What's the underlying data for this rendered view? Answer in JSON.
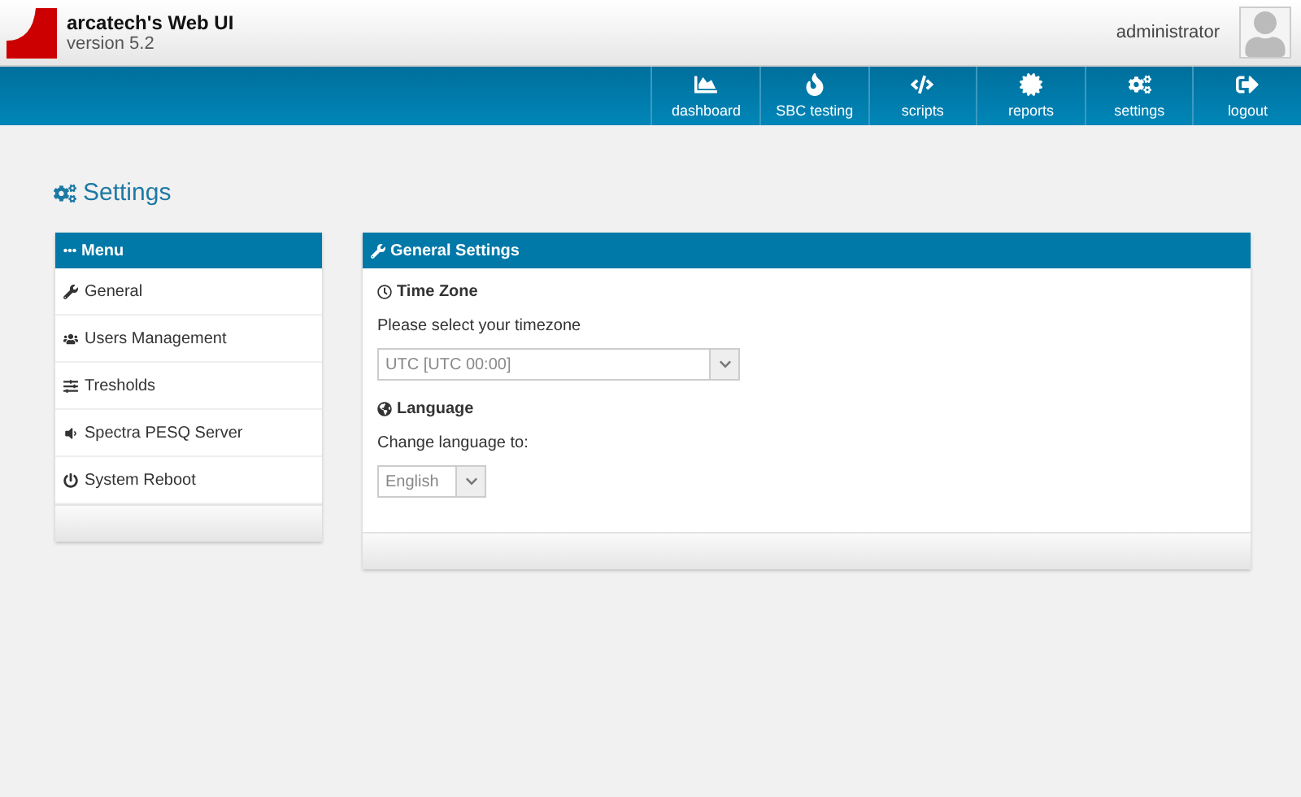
{
  "app": {
    "title": "arcatech's Web UI",
    "version": "version 5.2",
    "user": "administrator"
  },
  "nav": [
    {
      "kind": "dashboard",
      "label": "dashboard"
    },
    {
      "kind": "flame",
      "label": "SBC testing"
    },
    {
      "kind": "code",
      "label": "scripts"
    },
    {
      "kind": "badge",
      "label": "reports"
    },
    {
      "kind": "cogs",
      "label": "settings"
    },
    {
      "kind": "logout",
      "label": "logout"
    }
  ],
  "page_title": "Settings",
  "menu": {
    "title": "Menu",
    "items": [
      {
        "kind": "wrench",
        "label": "General"
      },
      {
        "kind": "users",
        "label": "Users Management"
      },
      {
        "kind": "sliders",
        "label": "Tresholds"
      },
      {
        "kind": "speaker",
        "label": "Spectra PESQ Server"
      },
      {
        "kind": "power",
        "label": "System Reboot"
      }
    ]
  },
  "general": {
    "title": "General Settings",
    "sections": [
      {
        "kind": "clock",
        "heading": "Time Zone",
        "prompt": "Please select your timezone",
        "value": "UTC [UTC 00:00]"
      },
      {
        "kind": "globe",
        "heading": "Language",
        "prompt": "Change language to:",
        "value": "English"
      }
    ]
  }
}
